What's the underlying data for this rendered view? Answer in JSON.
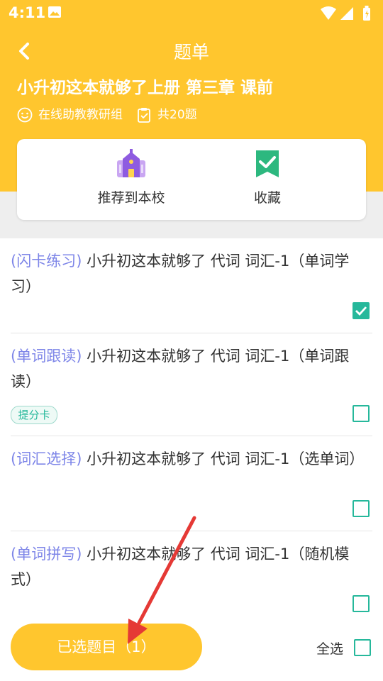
{
  "status_bar": {
    "time": "4:11"
  },
  "header": {
    "title": "题单",
    "set_title": "小升初这本就够了上册 第三章 课前",
    "author": "在线助教教研组",
    "question_count": "共20题"
  },
  "actions": [
    {
      "label": "推荐到本校",
      "icon": "school-icon"
    },
    {
      "label": "收藏",
      "icon": "bookmark-icon"
    }
  ],
  "items": [
    {
      "tag": "(闪卡练习)",
      "text": " 小升初这本就够了 代词 词汇-1（单词学习）",
      "checked": true,
      "badge": ""
    },
    {
      "tag": "(单词跟读)",
      "text": " 小升初这本就够了 代词 词汇-1（单词跟读）",
      "checked": false,
      "badge": "提分卡"
    },
    {
      "tag": "(词汇选择)",
      "text": " 小升初这本就够了 代词 词汇-1（选单词）",
      "checked": false,
      "badge": ""
    },
    {
      "tag": "(单词拼写)",
      "text": " 小升初这本就够了 代词 词汇-1（随机模式）",
      "checked": false,
      "badge": ""
    }
  ],
  "footer": {
    "selected_label": "已选题目（1）",
    "select_all_label": "全选"
  },
  "colors": {
    "brand_yellow": "#FFC62E",
    "accent_green": "#26B89B",
    "tag_purple": "#7E86E8",
    "annotation_red": "#E53935"
  }
}
